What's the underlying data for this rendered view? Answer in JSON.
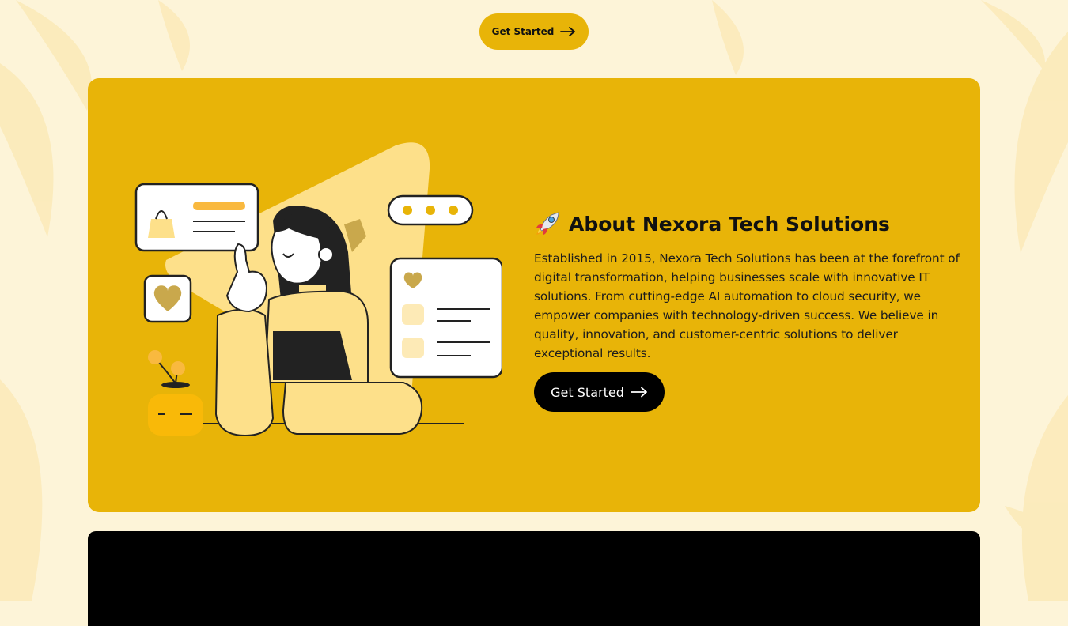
{
  "hero": {
    "cta_label": "Get Started"
  },
  "about": {
    "title": "About Nexora Tech Solutions",
    "description": "Established in 2015, Nexora Tech Solutions has been at the forefront of digital transformation, helping businesses scale with innovative IT solutions. From cutting-edge AI automation to cloud security, we empower companies with technology-driven success. We believe in quality, innovation, and customer-centric solutions to deliver exceptional results.",
    "cta_label": "Get Started",
    "icons": {
      "title_icon": "rocket-icon",
      "cta_icon": "arrow-right-icon"
    }
  },
  "colors": {
    "page_background": "#fdf4d8",
    "accent": "#e8b408",
    "illustration_light": "#fde08a",
    "dark": "#000000"
  }
}
